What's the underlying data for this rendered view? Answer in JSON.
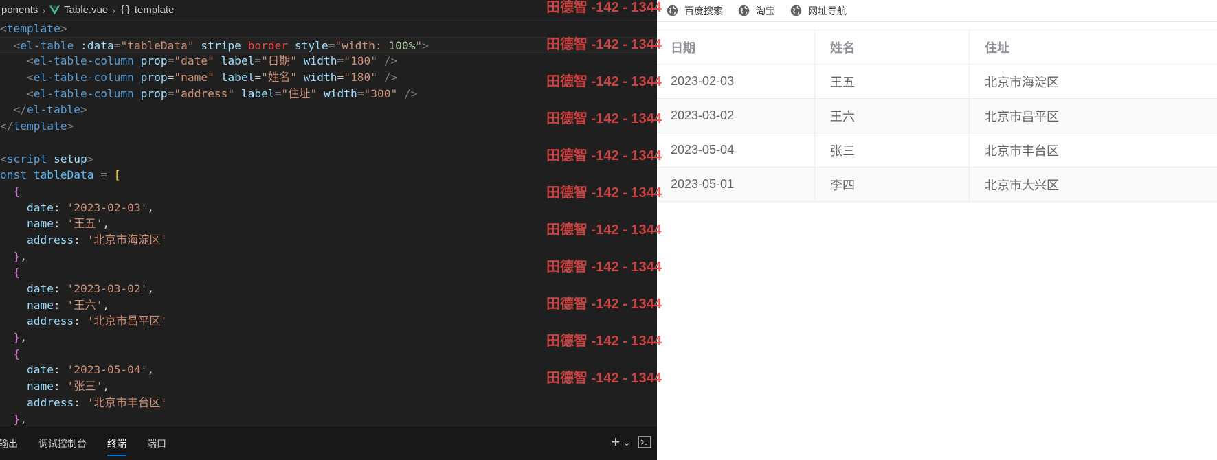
{
  "editor": {
    "breadcrumb": {
      "folder": "ponents",
      "file": "Table.vue",
      "symbol": "template"
    },
    "code_lines": [
      [
        [
          "t-br",
          "<"
        ],
        [
          "t-tag",
          "template"
        ],
        [
          "t-br",
          ">"
        ]
      ],
      [
        [
          "",
          "  "
        ],
        [
          "t-br",
          "<"
        ],
        [
          "t-tag",
          "el-table"
        ],
        [
          "",
          ""
        ],
        [
          "t-attr",
          " :data"
        ],
        [
          "t-white",
          "="
        ],
        [
          "t-str",
          "\"tableData\""
        ],
        [
          "t-attr",
          " stripe"
        ],
        [
          "t-red",
          " border"
        ],
        [
          "t-attr",
          " style"
        ],
        [
          "t-white",
          "="
        ],
        [
          "t-str",
          "\"width: "
        ],
        [
          "t-num",
          "100%"
        ],
        [
          "t-str",
          "\""
        ],
        [
          "t-br",
          ">"
        ]
      ],
      [
        [
          "",
          "    "
        ],
        [
          "t-br",
          "<"
        ],
        [
          "t-tag",
          "el-table-column"
        ],
        [
          "t-attr",
          " prop"
        ],
        [
          "t-white",
          "="
        ],
        [
          "t-str",
          "\"date\""
        ],
        [
          "t-attr",
          " label"
        ],
        [
          "t-white",
          "="
        ],
        [
          "t-str",
          "\"日期\""
        ],
        [
          "t-attr",
          " width"
        ],
        [
          "t-white",
          "="
        ],
        [
          "t-str",
          "\"180\""
        ],
        [
          "t-br",
          " />"
        ]
      ],
      [
        [
          "",
          "    "
        ],
        [
          "t-br",
          "<"
        ],
        [
          "t-tag",
          "el-table-column"
        ],
        [
          "t-attr",
          " prop"
        ],
        [
          "t-white",
          "="
        ],
        [
          "t-str",
          "\"name\""
        ],
        [
          "t-attr",
          " label"
        ],
        [
          "t-white",
          "="
        ],
        [
          "t-str",
          "\"姓名\""
        ],
        [
          "t-attr",
          " width"
        ],
        [
          "t-white",
          "="
        ],
        [
          "t-str",
          "\"180\""
        ],
        [
          "t-br",
          " />"
        ]
      ],
      [
        [
          "",
          "    "
        ],
        [
          "t-br",
          "<"
        ],
        [
          "t-tag",
          "el-table-column"
        ],
        [
          "t-attr",
          " prop"
        ],
        [
          "t-white",
          "="
        ],
        [
          "t-str",
          "\"address\""
        ],
        [
          "t-attr",
          " label"
        ],
        [
          "t-white",
          "="
        ],
        [
          "t-str",
          "\"住址\""
        ],
        [
          "t-attr",
          " width"
        ],
        [
          "t-white",
          "="
        ],
        [
          "t-str",
          "\"300\""
        ],
        [
          "t-br",
          " />"
        ]
      ],
      [
        [
          "",
          "  "
        ],
        [
          "t-br",
          "</"
        ],
        [
          "t-tag",
          "el-table"
        ],
        [
          "t-br",
          ">"
        ]
      ],
      [
        [
          "t-br",
          "</"
        ],
        [
          "t-tag",
          "template"
        ],
        [
          "t-br",
          ">"
        ]
      ],
      [
        [
          "",
          ""
        ]
      ],
      [
        [
          "t-br",
          "<"
        ],
        [
          "t-tag",
          "script"
        ],
        [
          "t-attr",
          " setup"
        ],
        [
          "t-br",
          ">"
        ]
      ],
      [
        [
          "t-kw",
          "onst"
        ],
        [
          "t-var",
          " tableData"
        ],
        [
          "t-white",
          " = "
        ],
        [
          "t-gold",
          "["
        ]
      ],
      [
        [
          "",
          "  "
        ],
        [
          "t-pink",
          "{"
        ]
      ],
      [
        [
          "",
          "    "
        ],
        [
          "t-prop",
          "date"
        ],
        [
          "t-white",
          ": "
        ],
        [
          "t-str",
          "'2023-02-03'"
        ],
        [
          "t-white",
          ","
        ]
      ],
      [
        [
          "",
          "    "
        ],
        [
          "t-prop",
          "name"
        ],
        [
          "t-white",
          ": "
        ],
        [
          "t-str",
          "'王五'"
        ],
        [
          "t-white",
          ","
        ]
      ],
      [
        [
          "",
          "    "
        ],
        [
          "t-prop",
          "address"
        ],
        [
          "t-white",
          ": "
        ],
        [
          "t-str",
          "'北京市海淀区'"
        ]
      ],
      [
        [
          "",
          "  "
        ],
        [
          "t-pink",
          "}"
        ],
        [
          "t-white",
          ","
        ]
      ],
      [
        [
          "",
          "  "
        ],
        [
          "t-pink",
          "{"
        ]
      ],
      [
        [
          "",
          "    "
        ],
        [
          "t-prop",
          "date"
        ],
        [
          "t-white",
          ": "
        ],
        [
          "t-str",
          "'2023-03-02'"
        ],
        [
          "t-white",
          ","
        ]
      ],
      [
        [
          "",
          "    "
        ],
        [
          "t-prop",
          "name"
        ],
        [
          "t-white",
          ": "
        ],
        [
          "t-str",
          "'王六'"
        ],
        [
          "t-white",
          ","
        ]
      ],
      [
        [
          "",
          "    "
        ],
        [
          "t-prop",
          "address"
        ],
        [
          "t-white",
          ": "
        ],
        [
          "t-str",
          "'北京市昌平区'"
        ]
      ],
      [
        [
          "",
          "  "
        ],
        [
          "t-pink",
          "}"
        ],
        [
          "t-white",
          ","
        ]
      ],
      [
        [
          "",
          "  "
        ],
        [
          "t-pink",
          "{"
        ]
      ],
      [
        [
          "",
          "    "
        ],
        [
          "t-prop",
          "date"
        ],
        [
          "t-white",
          ": "
        ],
        [
          "t-str",
          "'2023-05-04'"
        ],
        [
          "t-white",
          ","
        ]
      ],
      [
        [
          "",
          "    "
        ],
        [
          "t-prop",
          "name"
        ],
        [
          "t-white",
          ": "
        ],
        [
          "t-str",
          "'张三'"
        ],
        [
          "t-white",
          ","
        ]
      ],
      [
        [
          "",
          "    "
        ],
        [
          "t-prop",
          "address"
        ],
        [
          "t-white",
          ": "
        ],
        [
          "t-str",
          "'北京市丰台区'"
        ]
      ],
      [
        [
          "",
          "  "
        ],
        [
          "t-pink",
          "}"
        ],
        [
          "t-white",
          ","
        ]
      ]
    ],
    "panel_tabs": [
      "输出",
      "调试控制台",
      "终端",
      "端口"
    ],
    "panel_active_tab": 2,
    "panel_actions": {
      "add_label": "+",
      "dropdown_label": "⌄"
    }
  },
  "browser": {
    "bookmarks": [
      "百度搜索",
      "淘宝",
      "网址导航"
    ],
    "table": {
      "headers": [
        "日期",
        "姓名",
        "住址"
      ],
      "rows": [
        [
          "2023-02-03",
          "王五",
          "北京市海淀区"
        ],
        [
          "2023-03-02",
          "王六",
          "北京市昌平区"
        ],
        [
          "2023-05-04",
          "张三",
          "北京市丰台区"
        ],
        [
          "2023-05-01",
          "李四",
          "北京市大兴区"
        ]
      ]
    }
  },
  "watermark": {
    "text": "田德智 -142 - 1344",
    "count": 11
  },
  "colors": {
    "editor_bg": "#1f1f1f",
    "accent": "#0078d4",
    "watermark": "#e84848",
    "vue_green": "#41b883"
  }
}
